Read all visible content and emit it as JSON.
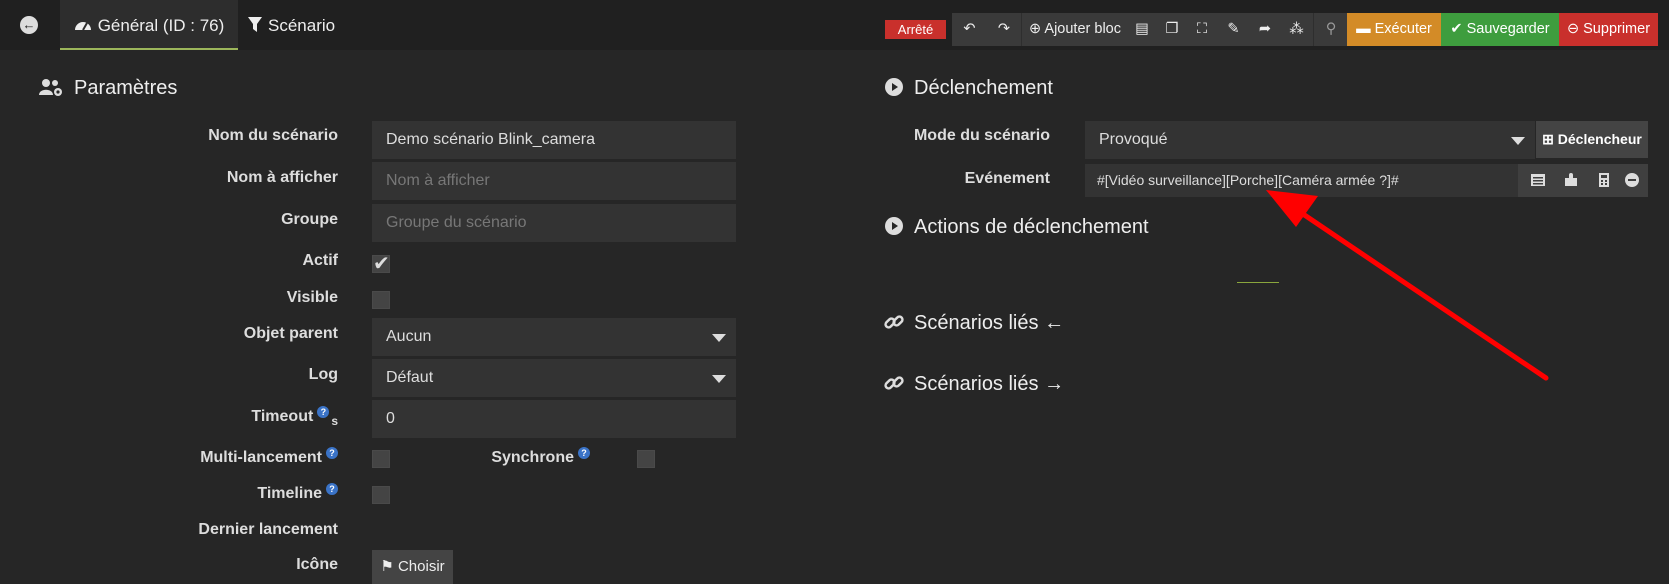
{
  "tabs": {
    "general": "Général (ID : 76)",
    "scenario": "Scénario"
  },
  "toolbar": {
    "status_badge": "Arrêté",
    "add_block": "Ajouter bloc",
    "execute": "Exécuter",
    "save": "Sauvegarder",
    "delete": "Supprimer"
  },
  "params": {
    "title": "Paramètres",
    "name_label": "Nom du scénario",
    "name_value": "Demo scénario Blink_camera",
    "display_label": "Nom à afficher",
    "display_placeholder": "Nom à afficher",
    "group_label": "Groupe",
    "group_placeholder": "Groupe du scénario",
    "active_label": "Actif",
    "active_checked": true,
    "visible_label": "Visible",
    "visible_checked": false,
    "parent_label": "Objet parent",
    "parent_value": "Aucun",
    "log_label": "Log",
    "log_value": "Défaut",
    "timeout_label": "Timeout",
    "timeout_unit": "s",
    "timeout_value": "0",
    "multi_label": "Multi-lancement",
    "sync_label": "Synchrone",
    "timeline_label": "Timeline",
    "last_launch_label": "Dernier lancement",
    "icon_label": "Icône",
    "choose_button": "Choisir"
  },
  "trigger": {
    "title": "Déclenchement",
    "mode_label": "Mode du scénario",
    "mode_value": "Provoqué",
    "trigger_button": "Déclencheur",
    "event_label": "Evénement",
    "event_value": "#[Vidéo surveillance][Porche][Caméra armée ?]#",
    "actions_title": "Actions de déclenchement",
    "linked_in_title": "Scénarios liés",
    "linked_out_title": "Scénarios liés"
  },
  "colors": {
    "accent_green": "#9cb65b",
    "danger": "#c9302c",
    "warning": "#d38b27",
    "success": "#3e9d3e",
    "arrow": "#ff0000"
  }
}
